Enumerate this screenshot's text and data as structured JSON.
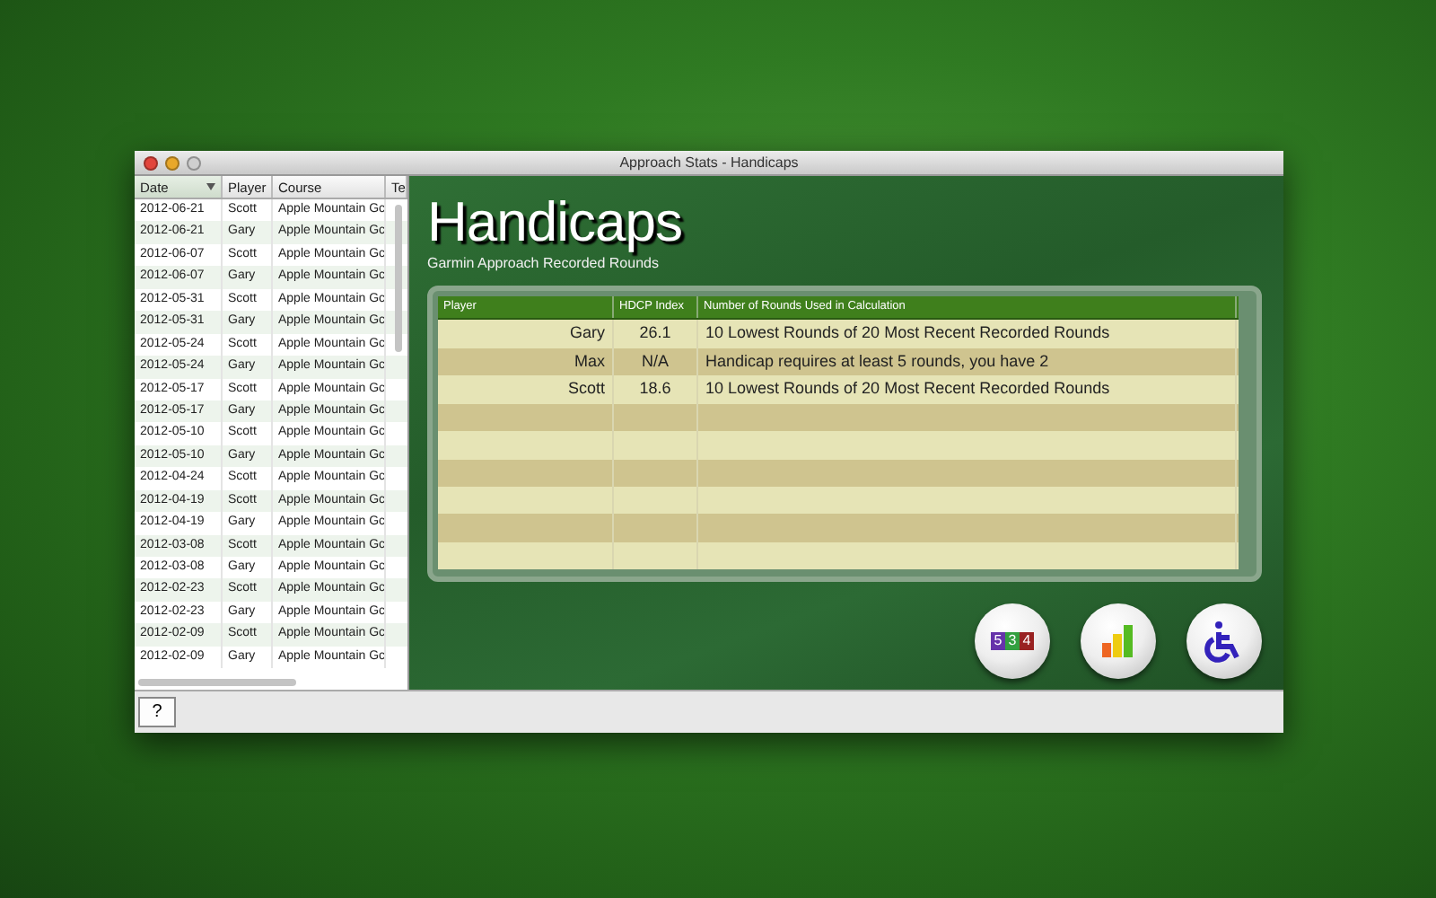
{
  "window": {
    "title": "Approach Stats - Handicaps"
  },
  "rounds_table": {
    "columns": [
      {
        "label": "Date",
        "sorted": true
      },
      {
        "label": "Player",
        "sorted": false
      },
      {
        "label": "Course",
        "sorted": false
      },
      {
        "label": "Te",
        "sorted": false
      }
    ],
    "rows": [
      {
        "date": "2012-06-21",
        "player": "Scott",
        "course": "Apple Mountain Gc"
      },
      {
        "date": "2012-06-21",
        "player": "Gary",
        "course": "Apple Mountain Gc"
      },
      {
        "date": "2012-06-07",
        "player": "Scott",
        "course": "Apple Mountain Gc"
      },
      {
        "date": "2012-06-07",
        "player": "Gary",
        "course": "Apple Mountain Gc"
      },
      {
        "date": "2012-05-31",
        "player": "Scott",
        "course": "Apple Mountain Gc"
      },
      {
        "date": "2012-05-31",
        "player": "Gary",
        "course": "Apple Mountain Gc"
      },
      {
        "date": "2012-05-24",
        "player": "Scott",
        "course": "Apple Mountain Gc"
      },
      {
        "date": "2012-05-24",
        "player": "Gary",
        "course": "Apple Mountain Gc"
      },
      {
        "date": "2012-05-17",
        "player": "Scott",
        "course": "Apple Mountain Gc"
      },
      {
        "date": "2012-05-17",
        "player": "Gary",
        "course": "Apple Mountain Gc"
      },
      {
        "date": "2012-05-10",
        "player": "Scott",
        "course": "Apple Mountain Gc"
      },
      {
        "date": "2012-05-10",
        "player": "Gary",
        "course": "Apple Mountain Gc"
      },
      {
        "date": "2012-04-24",
        "player": "Scott",
        "course": "Apple Mountain Gc"
      },
      {
        "date": "2012-04-19",
        "player": "Scott",
        "course": "Apple Mountain Gc"
      },
      {
        "date": "2012-04-19",
        "player": "Gary",
        "course": "Apple Mountain Gc"
      },
      {
        "date": "2012-03-08",
        "player": "Scott",
        "course": "Apple Mountain Gc"
      },
      {
        "date": "2012-03-08",
        "player": "Gary",
        "course": "Apple Mountain Gc"
      },
      {
        "date": "2012-02-23",
        "player": "Scott",
        "course": "Apple Mountain Gc"
      },
      {
        "date": "2012-02-23",
        "player": "Gary",
        "course": "Apple Mountain Gc"
      },
      {
        "date": "2012-02-09",
        "player": "Scott",
        "course": "Apple Mountain Gc"
      },
      {
        "date": "2012-02-09",
        "player": "Gary",
        "course": "Apple Mountain Gc"
      }
    ]
  },
  "heading": {
    "title": "Handicaps",
    "subtitle": "Garmin Approach Recorded Rounds"
  },
  "handicap_table": {
    "columns": [
      "Player",
      "HDCP Index",
      "Number of Rounds Used in Calculation"
    ],
    "rows": [
      {
        "player": "Gary",
        "index": "26.1",
        "rounds": "10 Lowest Rounds of 20 Most Recent Recorded Rounds"
      },
      {
        "player": "Max",
        "index": "N/A",
        "rounds": "Handicap requires at least 5 rounds, you have 2"
      },
      {
        "player": "Scott",
        "index": "18.6",
        "rounds": "10 Lowest Rounds of 20 Most Recent Recorded Rounds"
      }
    ]
  },
  "ball_buttons": [
    {
      "kind": "scorecard",
      "digits": [
        "5",
        "3",
        "4"
      ]
    },
    {
      "kind": "chart"
    },
    {
      "kind": "handicap"
    }
  ],
  "help_button": "?"
}
